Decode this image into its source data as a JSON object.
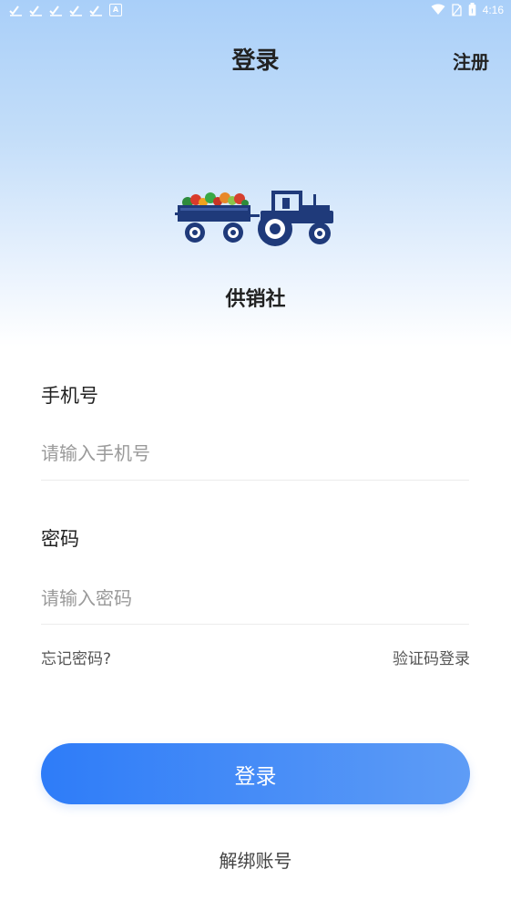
{
  "status_bar": {
    "time": "4:16",
    "notification_icons": [
      "check-icon",
      "check-icon",
      "check-icon",
      "check-icon",
      "check-icon",
      "a-icon"
    ],
    "system_icons": [
      "wifi-icon",
      "sim-icon",
      "battery-icon"
    ]
  },
  "header": {
    "title": "登录",
    "register_label": "注册"
  },
  "brand": {
    "name": "供销社",
    "logo_icon": "tractor-icon"
  },
  "form": {
    "phone": {
      "label": "手机号",
      "placeholder": "请输入手机号",
      "value": ""
    },
    "password": {
      "label": "密码",
      "placeholder": "请输入密码",
      "value": ""
    },
    "forgot_password": "忘记密码?",
    "sms_login": "验证码登录",
    "login_button": "登录",
    "unbind_account": "解绑账号"
  },
  "colors": {
    "accent_start": "#2e7cf8",
    "accent_end": "#5e9cf6",
    "header_gradient_top": "#a9cff9",
    "logo_navy": "#1f3a7a"
  }
}
